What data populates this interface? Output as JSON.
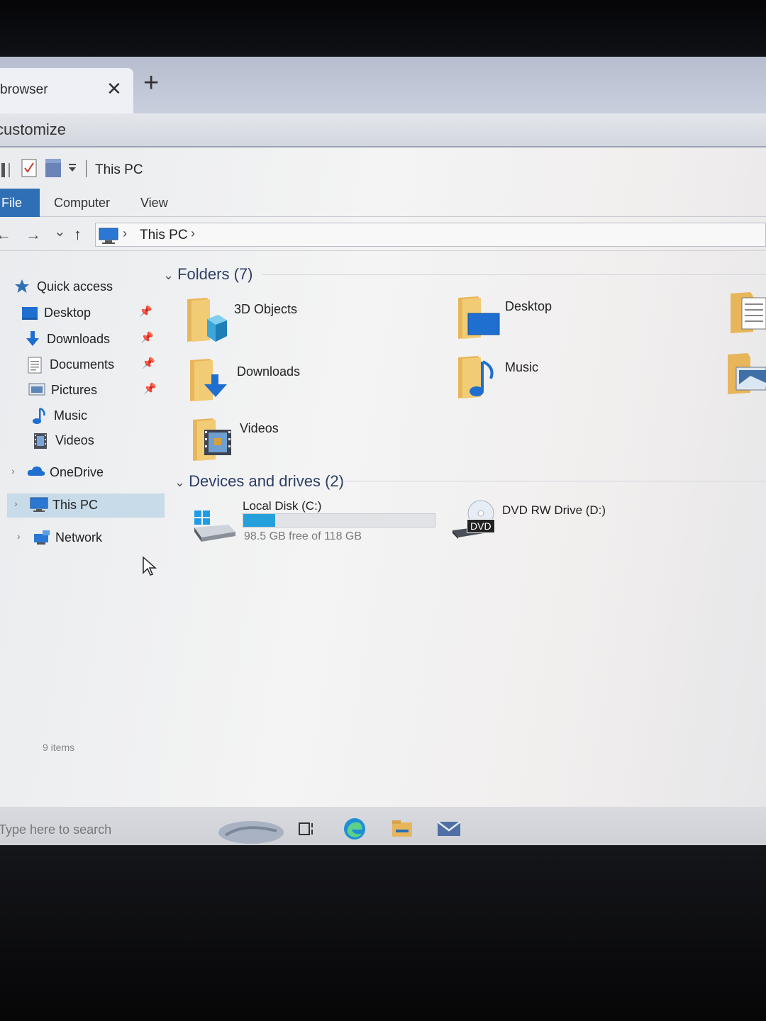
{
  "browser": {
    "tab_title": "browser",
    "tab_close": "✕",
    "new_tab": "+",
    "customize": "customize"
  },
  "explorer": {
    "title": "This PC",
    "ribbon": {
      "file": "File",
      "computer": "Computer",
      "view": "View"
    },
    "address": {
      "location": "This PC",
      "separator": "›"
    },
    "nav_buttons": {
      "back": "←",
      "forward": "→",
      "recent": "⌄",
      "up": "↑"
    }
  },
  "navigation": {
    "quick_access": "Quick access",
    "pinned": [
      {
        "label": "Desktop",
        "icon": "desktop-icon",
        "pinned": true
      },
      {
        "label": "Downloads",
        "icon": "downloads-icon",
        "pinned": true
      },
      {
        "label": "Documents",
        "icon": "documents-icon",
        "pinned": true
      },
      {
        "label": "Pictures",
        "icon": "pictures-icon",
        "pinned": true
      },
      {
        "label": "Music",
        "icon": "music-icon",
        "pinned": false
      },
      {
        "label": "Videos",
        "icon": "videos-icon",
        "pinned": false
      }
    ],
    "onedrive": "OneDrive",
    "this_pc": "This PC",
    "network": "Network",
    "pin_glyph": "📌",
    "expand_glyph": "›"
  },
  "content": {
    "folders_header": "Folders (7)",
    "folders": [
      {
        "label": "3D Objects",
        "icon": "3d-objects-folder-icon"
      },
      {
        "label": "Desktop",
        "icon": "desktop-folder-icon"
      },
      {
        "label": "Downloads",
        "icon": "downloads-folder-icon"
      },
      {
        "label": "Music",
        "icon": "music-folder-icon"
      },
      {
        "label": "Videos",
        "icon": "videos-folder-icon"
      }
    ],
    "devices_header": "Devices and drives (2)",
    "drives": [
      {
        "label": "Local Disk (C:)",
        "free_text": "98.5 GB free of 118 GB",
        "free_gb": 98.5,
        "total_gb": 118,
        "used_fraction": 0.165
      },
      {
        "label": "DVD RW Drive (D:)",
        "badge": "DVD"
      }
    ]
  },
  "status_bar": {
    "items": "9 items"
  },
  "taskbar": {
    "search_placeholder": "Type here to search"
  },
  "colors": {
    "accent": "#2f6fb6",
    "folder": "#e8b65a",
    "selection": "#c7dbe8",
    "capacity": "#26a0da"
  }
}
